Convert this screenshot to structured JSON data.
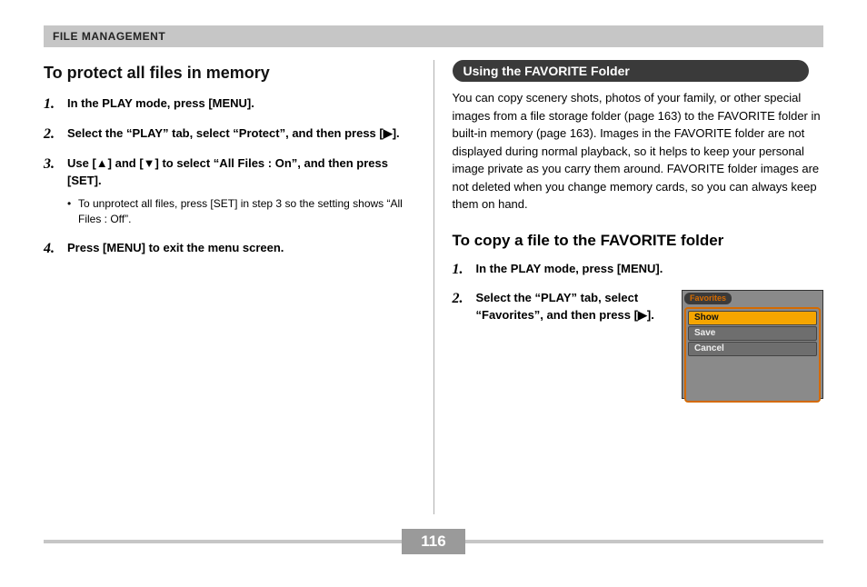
{
  "header": "FILE MANAGEMENT",
  "page_number": "116",
  "left": {
    "title": "To protect all files in memory",
    "steps": [
      {
        "text": "In the PLAY mode, press [MENU]."
      },
      {
        "text": "Select the “PLAY” tab, select “Protect”, and then press [▶]."
      },
      {
        "text": "Use [▲] and [▼] to select “All Files : On”, and then press [SET].",
        "note": "To unprotect all files, press [SET] in step 3 so the setting shows “All Files : Off”."
      },
      {
        "text": "Press [MENU] to exit the menu screen."
      }
    ]
  },
  "right": {
    "pill": "Using the FAVORITE Folder",
    "paragraph": "You can copy scenery shots, photos of your family, or other special images from a file storage folder (page 163) to the FAVORITE folder in built-in memory (page 163). Images in the FAVORITE folder are not displayed during normal playback, so it helps to keep your personal image private as you carry them around. FAVORITE folder images are not deleted when you change memory cards, so you can always keep them on hand.",
    "subtitle": "To copy a file to the FAVORITE folder",
    "steps": [
      {
        "text": "In the PLAY mode, press [MENU]."
      },
      {
        "text": "Select the “PLAY” tab, select “Favorites”, and then press [▶]."
      }
    ],
    "menu": {
      "title": "Favorites",
      "items": [
        "Show",
        "Save",
        "Cancel"
      ],
      "selected_index": 0
    }
  }
}
